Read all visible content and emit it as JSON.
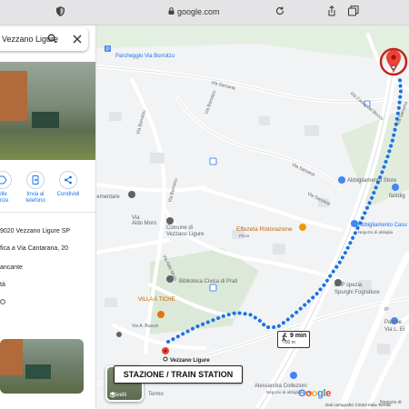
{
  "browser": {
    "url": "google.com"
  },
  "search": {
    "query": "Vezzano Ligure"
  },
  "panel": {
    "actions": [
      {
        "label": "elle\nanze",
        "icon": "label-icon"
      },
      {
        "label": "Invia al\ntelefono",
        "icon": "send-to-phone-icon"
      },
      {
        "label": "Condividi",
        "icon": "share-icon"
      }
    ],
    "info": [
      {
        "text": "9020 Vezzano Ligure SP",
        "icon": "location-icon"
      },
      {
        "text": "fica a Via Cantarana, 20",
        "icon": ""
      },
      {
        "text": "ancante",
        "icon": ""
      },
      {
        "text": "tà",
        "icon": ""
      }
    ]
  },
  "map": {
    "labels": {
      "parcheggio_borrotzu": "Parcheggio Via Borrotzu",
      "via_sarzana_top": "Via Sarzana",
      "via_borrotzu_1": "Via Borrotzu",
      "via_borrotzu_2": "Via Borrotzu",
      "via_borrotzu_3": "Via Borrotzu",
      "via_sarzana_mid": "Via Sarzana",
      "via_sarzana_low": "Via Sarzana",
      "via_castel": "Via Castel del Bocco",
      "via_sarzana_right": "Via Sarzana",
      "abbigliamento_store": "Abbigliamento Store",
      "fastdig": "fastdig",
      "abbigliamento_casu": "Abbigliamento Casu",
      "abbigliamento_casu_sub": "Negozio di abbiglia",
      "elementare": "lementare",
      "via_aldo_moro_1": "Via",
      "via_aldo_moro_2": "Aldo Moro",
      "comune_1": "Comune di",
      "comune_2": "Vezzano Ligure",
      "effezeta": "Effezeta Ristorazione",
      "effezeta_sub": "Pizza",
      "lap_1": "LAP spezia",
      "lap_2": "Spurghi Fognature",
      "biblioteca": "Biblioteca Civica di Prati",
      "via_aldo_moro_diag": "Via Aldo Moro",
      "villa_a_tiche": "VILLA A TICHE",
      "via_buozzi": "Via A. Buozzi",
      "vezzano_ligure_pin": "Vezzano Ligure",
      "parche_1": "Parche",
      "parche_2": "Via L. Ei",
      "alessandra": "Alessandra Collezioni",
      "alessandra_sub": "Negozio di abbigliamento",
      "termo": "Termo",
      "negozio_di": "Negozio di",
      "ip": "IP"
    },
    "caption": "STAZIONE / TRAIN STATION",
    "layers_label": "Livelli",
    "walk": {
      "time": "9 min",
      "distance": "700 m"
    },
    "attribution": "Dati cartografici ©2023   Italia   Termini",
    "route_color": "#1a73e8"
  }
}
